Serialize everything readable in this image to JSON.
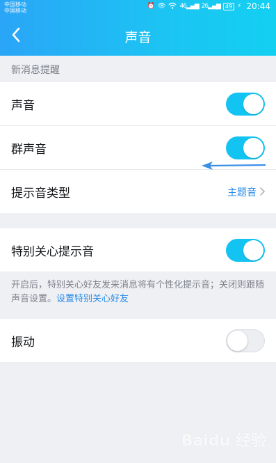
{
  "status_bar": {
    "carrier_1": "中国移动",
    "carrier_2": "中国移动",
    "signal_1": "46",
    "signal_2": "26",
    "battery": "49",
    "time": "20:44"
  },
  "header": {
    "title": "声音",
    "back_icon": "chevron-left-icon"
  },
  "section_title": "新消息提醒",
  "settings": [
    {
      "label": "声音",
      "type": "toggle",
      "on": true
    },
    {
      "label": "群声音",
      "type": "toggle",
      "on": true
    },
    {
      "label": "提示音类型",
      "type": "link",
      "value": "主题音"
    }
  ],
  "special": {
    "label": "特别关心提示音",
    "on": true,
    "hint_text": "开启后，特别关心好友发来消息将有个性化提示音；关闭则跟随声音设置。",
    "hint_link": "设置特别关心好友"
  },
  "vibrate": {
    "label": "振动",
    "on": false
  },
  "colors": {
    "header_gradient_start": "#2aa5f7",
    "header_gradient_end": "#13d0f1",
    "toggle_on": "#13c3f2",
    "link": "#2a8be8"
  },
  "watermark": "Baidu 经验"
}
